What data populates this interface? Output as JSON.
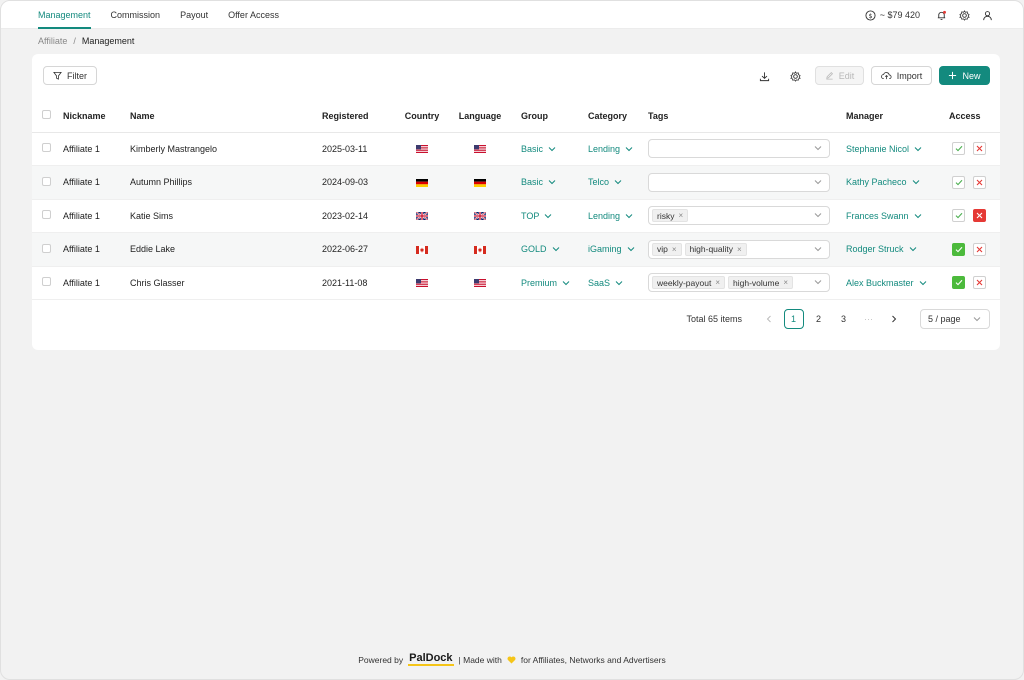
{
  "nav": {
    "tabs": [
      "Management",
      "Commission",
      "Payout",
      "Offer Access"
    ],
    "active_tab": 0,
    "balance": "~ $79 420"
  },
  "breadcrumb": {
    "root": "Affiliate",
    "sep": "/",
    "current": "Management"
  },
  "toolbar": {
    "filter": "Filter",
    "edit": "Edit",
    "import": "Import",
    "new": "New"
  },
  "table": {
    "headers": {
      "nickname": "Nickname",
      "name": "Name",
      "registered": "Registered",
      "country": "Country",
      "language": "Language",
      "group": "Group",
      "category": "Category",
      "tags": "Tags",
      "manager": "Manager",
      "access": "Access"
    },
    "rows": [
      {
        "nickname": "Affiliate 1",
        "name": "Kimberly Mastrangelo",
        "registered": "2025-03-11",
        "country_flag": "us",
        "language_flag": "us",
        "group": "Basic",
        "category": "Lending",
        "tags": [],
        "manager": "Stephanie Nicol",
        "access": "none"
      },
      {
        "nickname": "Affiliate 1",
        "name": "Autumn Phillips",
        "registered": "2024-09-03",
        "country_flag": "de",
        "language_flag": "de",
        "group": "Basic",
        "category": "Telco",
        "tags": [],
        "manager": "Kathy Pacheco",
        "access": "none"
      },
      {
        "nickname": "Affiliate 1",
        "name": "Katie Sims",
        "registered": "2023-02-14",
        "country_flag": "gb",
        "language_flag": "gb",
        "group": "TOP",
        "category": "Lending",
        "tags": [
          "risky"
        ],
        "manager": "Frances Swann",
        "access": "denied"
      },
      {
        "nickname": "Affiliate 1",
        "name": "Eddie Lake",
        "registered": "2022-06-27",
        "country_flag": "ca",
        "language_flag": "ca",
        "group": "GOLD",
        "category": "iGaming",
        "tags": [
          "vip",
          "high-quality"
        ],
        "manager": "Rodger Struck",
        "access": "approved"
      },
      {
        "nickname": "Affiliate 1",
        "name": "Chris Glasser",
        "registered": "2021-11-08",
        "country_flag": "us",
        "language_flag": "us",
        "group": "Premium",
        "category": "SaaS",
        "tags": [
          "weekly-payout",
          "high-volume"
        ],
        "manager": "Alex Buckmaster",
        "access": "approved"
      }
    ]
  },
  "pagination": {
    "total": "Total 65 items",
    "pages": [
      "1",
      "2",
      "3"
    ],
    "ellipsis": "···",
    "current": "1",
    "page_size": "5 / page"
  },
  "footer": {
    "powered": "Powered by",
    "brand": "PalDock",
    "made": "| Made with",
    "tail": "for Affiliates, Networks and Advertisers"
  },
  "colors": {
    "accent": "#138a7e",
    "approve": "#4cba3c",
    "deny": "#e53935",
    "heart": "#f5c518"
  },
  "icons": {
    "balance": "dollar-circle-icon",
    "notify": "bell-icon",
    "settings": "gear-icon",
    "user": "user-icon"
  }
}
